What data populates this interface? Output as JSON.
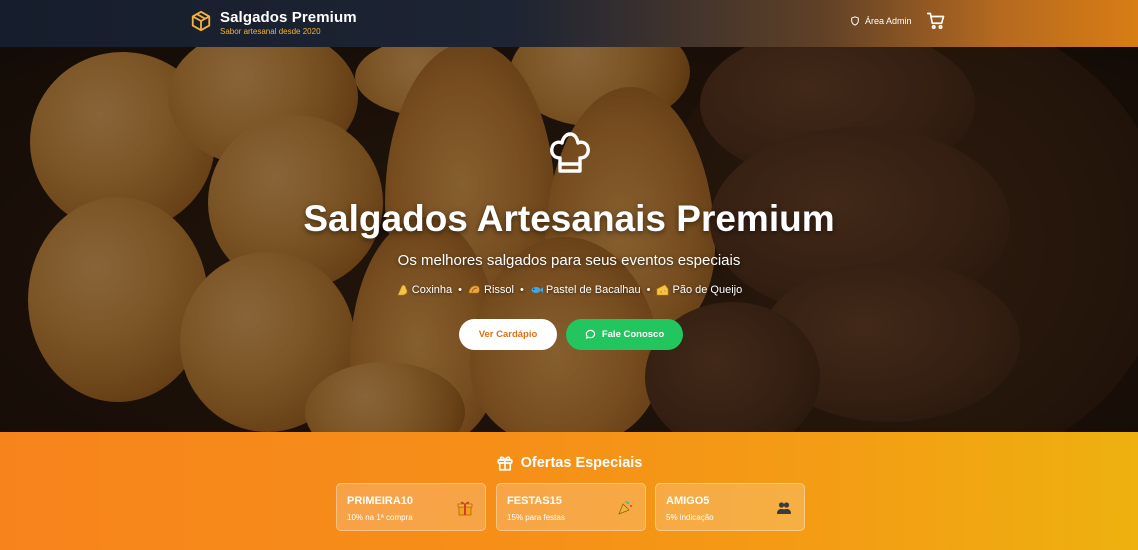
{
  "header": {
    "brand_name": "Salgados Premium",
    "brand_tagline": "Sabor artesanal desde 2020",
    "admin_label": "Área Admin",
    "colors": {
      "tagline": "#f5b335",
      "background_start": "#161d2c",
      "background_end": "#d97d14"
    }
  },
  "hero": {
    "title": "Salgados Artesanais Premium",
    "subtitle": "Os melhores salgados para seus eventos especiais",
    "products": [
      {
        "name": "Coxinha",
        "icon": "coxinha-emoji-icon"
      },
      {
        "name": "Rissol",
        "icon": "rissol-emoji-icon"
      },
      {
        "name": "Pastel de Bacalhau",
        "icon": "fish-emoji-icon"
      },
      {
        "name": "Pão de Queijo",
        "icon": "cheese-emoji-icon"
      }
    ],
    "separator": "•",
    "menu_button": "Ver Cardápio",
    "contact_button": "Fale Conosco",
    "colors": {
      "menu_text": "#d9731a",
      "contact_bg": "#22c55e"
    }
  },
  "offers": {
    "title": "Ofertas Especiais",
    "coupons": [
      {
        "code": "PRIMEIRA10",
        "description": "10% na 1ª compra",
        "icon": "gift-emoji-icon"
      },
      {
        "code": "FESTAS15",
        "description": "15% para festas",
        "icon": "party-popper-emoji-icon"
      },
      {
        "code": "AMIGO5",
        "description": "5% indicação",
        "icon": "people-emoji-icon"
      }
    ],
    "colors": {
      "gradient_start": "#f7831c",
      "gradient_end": "#eeb10f"
    }
  }
}
